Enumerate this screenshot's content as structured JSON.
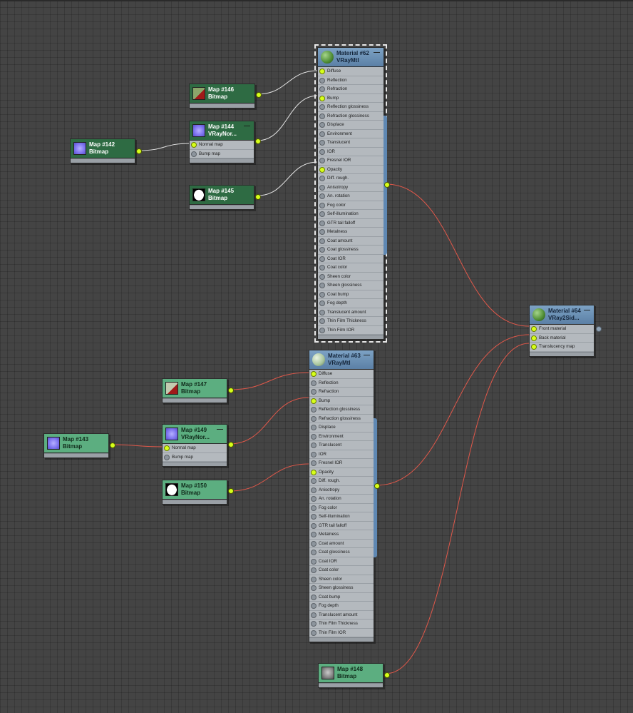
{
  "editor": {
    "materials": [
      {
        "title": "Material #62",
        "subtitle": "VRayMtl",
        "minimize_label": "—",
        "slots": [
          "Diffuse",
          "Reflection",
          "Refraction",
          "Bump",
          "Reflection glossiness",
          "Refraction glossiness",
          "Displace",
          "Environment",
          "Translucent",
          "IOR",
          "Fresnel IOR",
          "Opacity",
          "Diff. rough.",
          "Anisotropy",
          "An. rotation",
          "Fog color",
          "Self-illumination",
          "GTR tail falloff",
          "Metalness",
          "Coat amount",
          "Coat glossiness",
          "Coat IOR",
          "Coat color",
          "Sheen color",
          "Sheen glossiness",
          "Coat bump",
          "Fog depth",
          "Translucent amount",
          "Thin Film Thickness",
          "Thin Film IOR"
        ]
      },
      {
        "title": "Material #63",
        "subtitle": "VRayMtl",
        "minimize_label": "—",
        "slots": [
          "Diffuse",
          "Reflection",
          "Refraction",
          "Bump",
          "Reflection glossiness",
          "Refraction glossiness",
          "Displace",
          "Environment",
          "Translucent",
          "IOR",
          "Fresnel IOR",
          "Opacity",
          "Diff. rough.",
          "Anisotropy",
          "An. rotation",
          "Fog color",
          "Self-illumination",
          "GTR tail falloff",
          "Metalness",
          "Coat amount",
          "Coat glossiness",
          "Coat IOR",
          "Coat color",
          "Sheen color",
          "Sheen glossiness",
          "Coat bump",
          "Fog depth",
          "Translucent amount",
          "Thin Film Thickness",
          "Thin Film IOR"
        ]
      },
      {
        "title": "Material #64",
        "subtitle": "VRay2Sid...",
        "minimize_label": "—",
        "slots": [
          "Front material",
          "Back material",
          "Translucency map"
        ]
      }
    ],
    "maps": [
      {
        "title": "Map #146",
        "subtitle": "Bitmap"
      },
      {
        "title": "Map #144",
        "subtitle": "VRayNor...",
        "minimize_label": "—",
        "slots": [
          "Normal map",
          "Bump map"
        ]
      },
      {
        "title": "Map #142",
        "subtitle": "Bitmap"
      },
      {
        "title": "Map #145",
        "subtitle": "Bitmap"
      },
      {
        "title": "Map #147",
        "subtitle": "Bitmap"
      },
      {
        "title": "Map #149",
        "subtitle": "VRayNor...",
        "minimize_label": "—",
        "slots": [
          "Normal map",
          "Bump map"
        ]
      },
      {
        "title": "Map #143",
        "subtitle": "Bitmap"
      },
      {
        "title": "Map #150",
        "subtitle": "Bitmap"
      },
      {
        "title": "Map #148",
        "subtitle": "Bitmap"
      }
    ],
    "colors": {
      "wire_selected": "#e6e6e6",
      "wire_normal": "#e0584a",
      "socket_connected": "#d7ff1a"
    }
  }
}
